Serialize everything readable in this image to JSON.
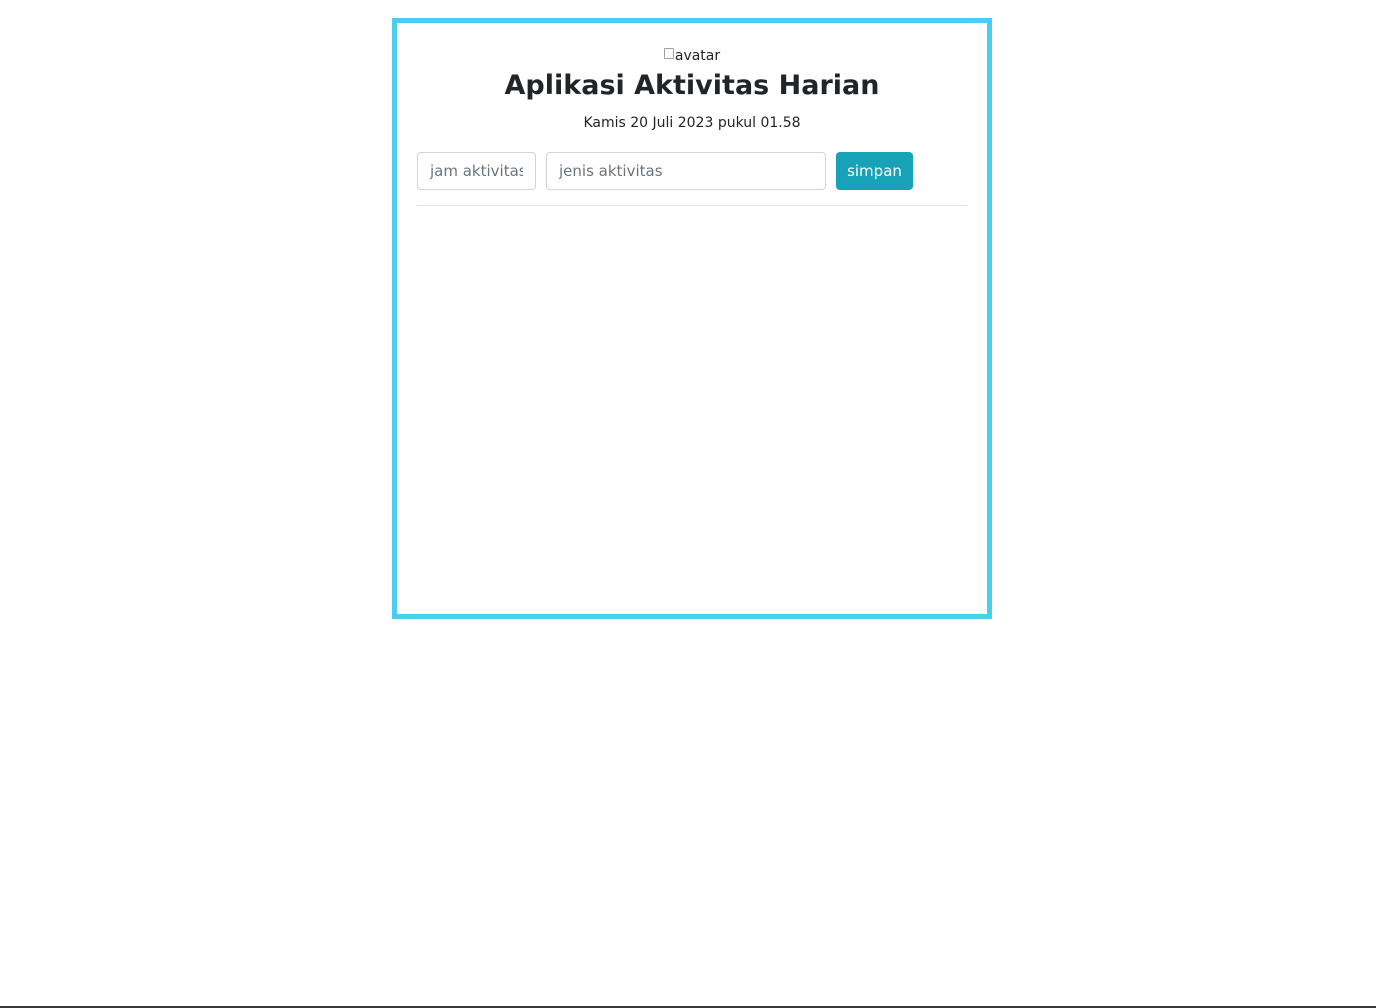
{
  "header": {
    "avatar_alt": "avatar",
    "title": "Aplikasi Aktivitas Harian",
    "date": "Kamis 20 Juli 2023 pukul 01.58"
  },
  "form": {
    "time_placeholder": "jam aktivitas",
    "activity_placeholder": "jenis aktivitas",
    "save_label": "simpan"
  },
  "activities": [],
  "colors": {
    "card_border": "#4cccee",
    "button_bg": "#17a2b8",
    "button_text": "#ffffff",
    "title_text": "#212529"
  }
}
